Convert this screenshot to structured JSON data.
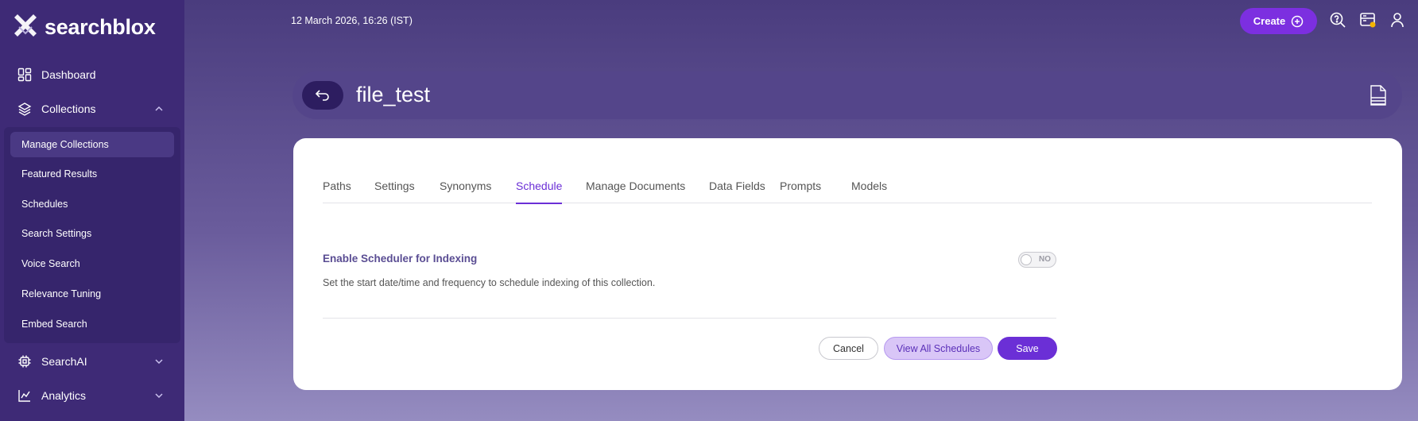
{
  "app": {
    "logo_text": "searchblox"
  },
  "colors": {
    "accent": "#6b2fd6",
    "sidebar": "#3e2a76",
    "create": "#7c2fe0"
  },
  "sidebar": {
    "items": [
      {
        "label": "Dashboard",
        "icon": "dashboard-icon"
      },
      {
        "label": "Collections",
        "icon": "layers-icon",
        "expanded": true
      },
      {
        "label": "SearchAI",
        "icon": "chip-icon",
        "expanded": false
      },
      {
        "label": "Analytics",
        "icon": "analytics-icon",
        "expanded": false
      }
    ],
    "sub_items": [
      {
        "label": "Manage Collections",
        "active": true
      },
      {
        "label": "Featured Results"
      },
      {
        "label": "Schedules"
      },
      {
        "label": "Search Settings"
      },
      {
        "label": "Voice Search"
      },
      {
        "label": "Relevance Tuning"
      },
      {
        "label": "Embed Search"
      }
    ]
  },
  "header": {
    "datetime": "12 March 2026, 16:26 (IST)",
    "create_label": "Create",
    "icons": [
      "search-help-icon",
      "server-notification-icon",
      "user-icon"
    ]
  },
  "page": {
    "title": "file_test",
    "tabs": [
      "Paths",
      "Settings",
      "Synonyms",
      "Schedule",
      "Manage Documents",
      "Data Fields",
      "Prompts",
      "Models"
    ],
    "active_tab": "Schedule"
  },
  "schedule": {
    "title": "Enable Scheduler for Indexing",
    "description": "Set the start date/time and frequency to schedule indexing of this collection.",
    "toggle_label": "NO",
    "enabled": false
  },
  "actions": {
    "cancel": "Cancel",
    "view_all": "View All Schedules",
    "save": "Save"
  }
}
